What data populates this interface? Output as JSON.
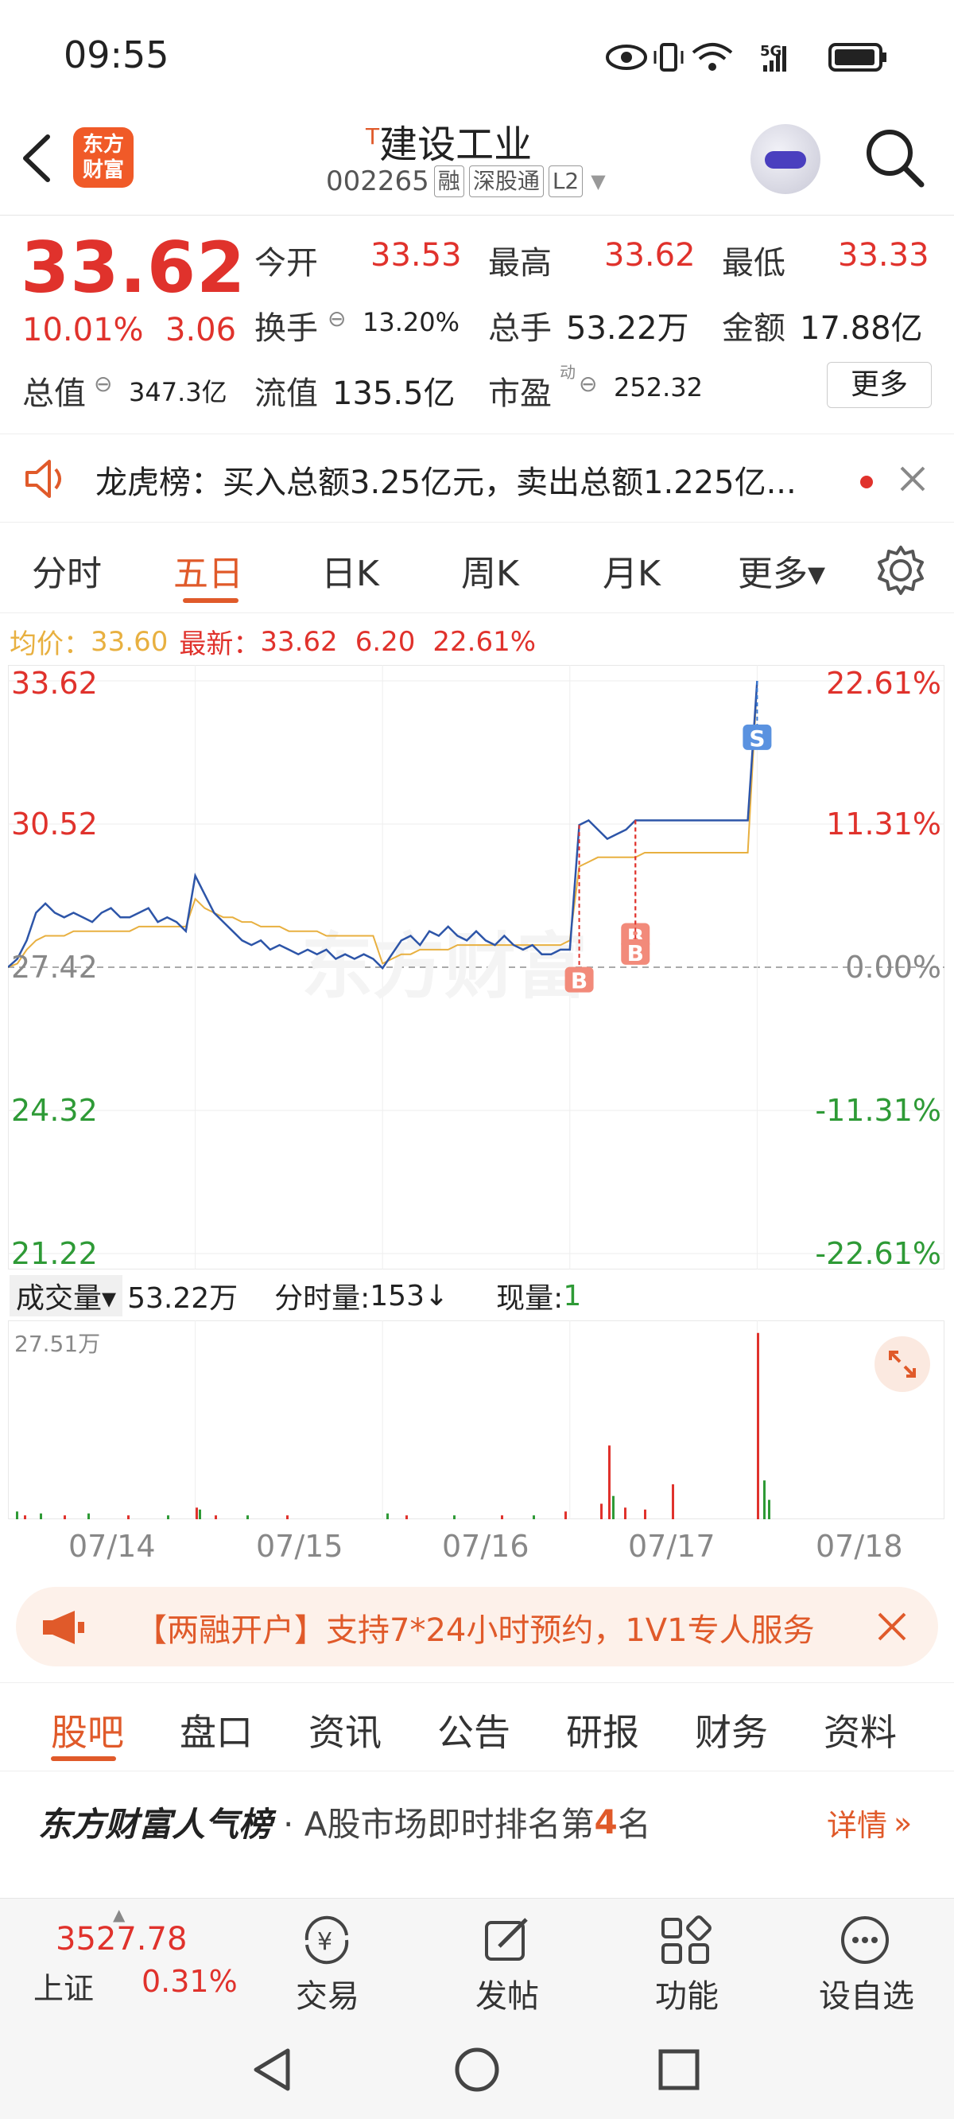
{
  "status_bar": {
    "time": "09:55",
    "network": "5G"
  },
  "header": {
    "logo_text": "东方财富",
    "title_prefix": "T",
    "title": "建设工业",
    "code": "002265",
    "tags": [
      "融",
      "深股通",
      "L2"
    ]
  },
  "quote": {
    "price": "33.62",
    "change_pct": "10.01%",
    "change_amt": "3.06",
    "labels": {
      "open": "今开",
      "high": "最高",
      "low": "最低",
      "turnover": "换手",
      "volume": "总手",
      "amount": "金额",
      "mktcap": "总值",
      "float": "流值",
      "pe": "市盈",
      "pe_sup": "动"
    },
    "open": "33.53",
    "high": "33.62",
    "low": "33.33",
    "turnover": "13.20%",
    "volume": "53.22万",
    "amount": "17.88亿",
    "mktcap": "347.3亿",
    "float": "135.5亿",
    "pe": "252.32",
    "more_label": "更多"
  },
  "longhu": {
    "text": "龙虎榜：买入总额3.25亿元，卖出总额1.225亿..."
  },
  "chart_tabs": {
    "items": [
      "分时",
      "五日",
      "日K",
      "周K",
      "月K",
      "更多▾"
    ],
    "active_index": 1
  },
  "chart_info": {
    "avg_label": "均价：",
    "avg": "33.60",
    "latest_label": "最新：",
    "latest": "33.62",
    "change_amt": "6.20",
    "change_pct": "22.61%"
  },
  "chart_data": {
    "type": "line",
    "x_labels": [
      "07/14",
      "07/15",
      "07/16",
      "07/17",
      "07/18"
    ],
    "y_left_ticks": [
      "33.62",
      "30.52",
      "27.42",
      "24.32",
      "21.22"
    ],
    "y_right_ticks": [
      "22.61%",
      "11.31%",
      "0.00%",
      "-11.31%",
      "-22.61%"
    ],
    "ylim": [
      21.22,
      33.62
    ],
    "baseline": 27.42,
    "series": [
      {
        "name": "最新",
        "color": "#2d55a8",
        "values": [
          27.42,
          27.6,
          28.0,
          28.6,
          28.8,
          28.6,
          28.5,
          28.6,
          28.5,
          28.4,
          28.6,
          28.7,
          28.5,
          28.5,
          28.6,
          28.7,
          28.4,
          28.5,
          28.4,
          28.2,
          29.4,
          29.0,
          28.6,
          28.4,
          28.2,
          28.0,
          27.9,
          28.0,
          27.8,
          27.9,
          27.8,
          27.7,
          27.8,
          27.7,
          27.8,
          27.6,
          27.7,
          27.6,
          27.7,
          27.6,
          27.4,
          27.7,
          28.0,
          28.1,
          27.9,
          28.2,
          28.1,
          28.3,
          28.1,
          28.0,
          28.2,
          28.0,
          27.9,
          28.1,
          27.9,
          27.8,
          27.9,
          27.7,
          27.7,
          27.8,
          27.8,
          30.5,
          30.6,
          30.4,
          30.2,
          30.3,
          30.4,
          30.6,
          30.6,
          30.6,
          30.6,
          30.6,
          30.6,
          30.6,
          30.6,
          30.6,
          30.6,
          30.6,
          30.6,
          30.6,
          33.62
        ]
      },
      {
        "name": "均价",
        "color": "#e8b040",
        "values": [
          27.42,
          27.5,
          27.8,
          28.0,
          28.1,
          28.1,
          28.1,
          28.2,
          28.2,
          28.2,
          28.2,
          28.2,
          28.2,
          28.2,
          28.3,
          28.3,
          28.3,
          28.3,
          28.3,
          28.3,
          28.9,
          28.7,
          28.6,
          28.5,
          28.5,
          28.4,
          28.4,
          28.3,
          28.3,
          28.3,
          28.2,
          28.2,
          28.2,
          28.2,
          28.1,
          28.1,
          28.1,
          28.1,
          28.1,
          28.1,
          27.5,
          27.6,
          27.7,
          27.7,
          27.8,
          27.8,
          27.8,
          27.8,
          27.9,
          27.9,
          27.9,
          27.9,
          27.9,
          27.9,
          27.9,
          27.9,
          27.9,
          27.9,
          27.9,
          27.9,
          28.0,
          29.6,
          29.7,
          29.8,
          29.8,
          29.8,
          29.8,
          29.8,
          29.9,
          29.9,
          29.9,
          29.9,
          29.9,
          29.9,
          29.9,
          29.9,
          29.9,
          29.9,
          29.9,
          29.9,
          33.6
        ]
      }
    ],
    "markers": [
      {
        "label": "B",
        "color": "#e0322c"
      },
      {
        "label": "B",
        "color": "#e0322c"
      },
      {
        "label": "B",
        "color": "#e0322c"
      },
      {
        "label": "S",
        "color": "#3a7bd5"
      }
    ]
  },
  "volume": {
    "selector_label": "成交量▾",
    "total": "53.22万",
    "tick_label": "分时量:",
    "tick_value": "153",
    "tick_arrow": "↓",
    "now_label": "现量:",
    "now_value": "1",
    "max_label": "27.51万"
  },
  "promo": {
    "text": "【两融开户】支持7*24小时预约，1V1专人服务"
  },
  "bottom_tabs": {
    "items": [
      "股吧",
      "盘口",
      "资讯",
      "公告",
      "研报",
      "财务",
      "资料"
    ],
    "active_index": 0
  },
  "rank": {
    "brand": "东方财富人气榜",
    "text": "· A股市场即时排名第",
    "rank": "4",
    "suffix": "名",
    "detail": "详情"
  },
  "bottom_bar": {
    "index_value": "3527.78",
    "index_name": "上证",
    "index_change": "0.31%",
    "items": [
      "交易",
      "发帖",
      "功能",
      "设自选"
    ]
  },
  "colors": {
    "up": "#e0322c",
    "down": "#2e9a36",
    "accent": "#e05a2a",
    "price_line": "#2d55a8",
    "avg_line": "#e8b040"
  }
}
